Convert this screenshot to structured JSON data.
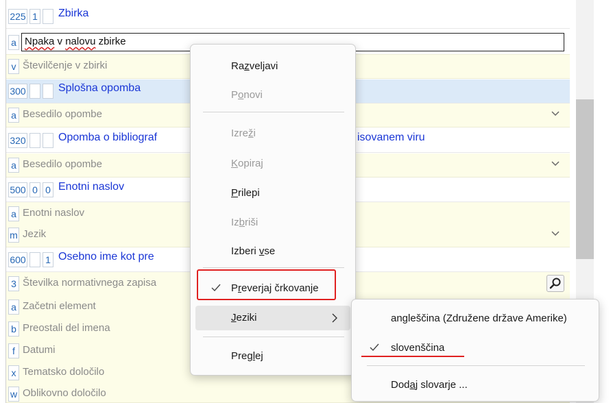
{
  "fields": [
    {
      "kind": "tag",
      "code": "225",
      "ind1": "1",
      "ind2": "",
      "title": "Zbirka"
    },
    {
      "kind": "edit",
      "sub": "a",
      "value_words": [
        "Npaka",
        " v ",
        "nalovu",
        " zbirke"
      ]
    },
    {
      "kind": "sub",
      "sub": "v",
      "text": "Številčenje v zbirki"
    },
    {
      "kind": "tag",
      "code": "300",
      "ind1": "",
      "ind2": "",
      "title": "Splošna opomba",
      "selected": true
    },
    {
      "kind": "sub",
      "sub": "a",
      "text": "Besedilo opombe",
      "dropdown": true
    },
    {
      "kind": "tag",
      "code": "320",
      "ind1": "",
      "ind2": "",
      "title": "Opomba o bibliograf",
      "title_tail": "isovanem viru"
    },
    {
      "kind": "sub",
      "sub": "a",
      "text": "Besedilo opombe",
      "dropdown": true
    },
    {
      "kind": "tag",
      "code": "500",
      "ind1": "0",
      "ind2": "0",
      "title": "Enotni naslov"
    },
    {
      "kind": "sub",
      "sub": "a",
      "text": "Enotni naslov"
    },
    {
      "kind": "sub",
      "sub": "m",
      "text": "Jezik",
      "dropdown": true
    },
    {
      "kind": "tag",
      "code": "600",
      "ind1": "",
      "ind2": "1",
      "title": "Osebno ime kot pre"
    },
    {
      "kind": "sub",
      "sub": "3",
      "text": "Številka normativnega zapisa",
      "lookup": true
    },
    {
      "kind": "sub",
      "sub": "a",
      "text": "Začetni element"
    },
    {
      "kind": "sub",
      "sub": "b",
      "text": "Preostali del imena"
    },
    {
      "kind": "sub",
      "sub": "f",
      "text": "Datumi"
    },
    {
      "kind": "sub",
      "sub": "x",
      "text": "Tematsko določilo"
    },
    {
      "kind": "sub",
      "sub": "w",
      "text": "Oblikovno določilo"
    }
  ],
  "context_menu": {
    "undo": {
      "pre": "Ra",
      "key": "z",
      "post": "veljavi"
    },
    "redo": {
      "pre": "P",
      "key": "o",
      "post": "novi"
    },
    "cut": {
      "pre": "Izre",
      "key": "ž",
      "post": "i"
    },
    "copy": {
      "pre": "",
      "key": "K",
      "post": "opiraj"
    },
    "paste": {
      "pre": "",
      "key": "P",
      "post": "rilepi"
    },
    "delete": {
      "pre": "Iz",
      "key": "b",
      "post": "riši"
    },
    "select_all": {
      "pre": "Izberi ",
      "key": "v",
      "post": "se"
    },
    "spellcheck": {
      "pre": "P",
      "key": "r",
      "post": "everjaj črkovanje"
    },
    "languages": {
      "pre": "",
      "key": "J",
      "post": "eziki"
    },
    "review": {
      "pre": "Preg",
      "key": "l",
      "post": "ej"
    }
  },
  "languages_menu": {
    "english": "angleščina (Združene države Amerike)",
    "slovenian": "slovenščina",
    "add_dict": {
      "pre": "Dod",
      "key": "a",
      "post": "j slovarje ..."
    }
  },
  "colors": {
    "accent": "#1a36d6",
    "highlight_red": "#e02020",
    "selected_row": "#dceaf8",
    "subfield_bg": "#fdfde8"
  }
}
